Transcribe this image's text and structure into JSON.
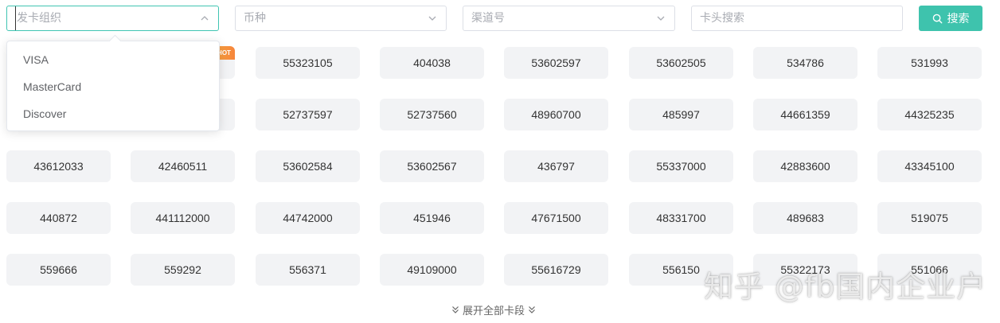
{
  "filters": {
    "card_org_placeholder": "发卡组织",
    "currency_placeholder": "币种",
    "channel_placeholder": "渠道号",
    "bin_search_placeholder": "卡头搜索",
    "search_label": "搜索"
  },
  "dropdown": {
    "options": [
      "VISA",
      "MasterCard",
      "Discover"
    ]
  },
  "hot_badge": "HOT",
  "bins": [
    [
      "",
      "",
      "55323105",
      "404038",
      "53602597",
      "53602505",
      "534786",
      "531993"
    ],
    [
      "",
      "",
      "52737597",
      "52737560",
      "48960700",
      "485997",
      "44661359",
      "44325235"
    ],
    [
      "43612033",
      "42460511",
      "53602584",
      "53602567",
      "436797",
      "55337000",
      "42883600",
      "43345100"
    ],
    [
      "440872",
      "441112000",
      "44742000",
      "451946",
      "47671500",
      "48331700",
      "489683",
      "519075"
    ],
    [
      "559666",
      "559292",
      "556371",
      "49109000",
      "55616729",
      "556150",
      "55322173",
      "551066"
    ]
  ],
  "expand_label": "展开全部卡段",
  "watermark": "知乎 @fb国内企业户",
  "colors": {
    "accent": "#3ec3ad",
    "chip_bg": "#f2f3f5",
    "badge": "#f6853b"
  }
}
